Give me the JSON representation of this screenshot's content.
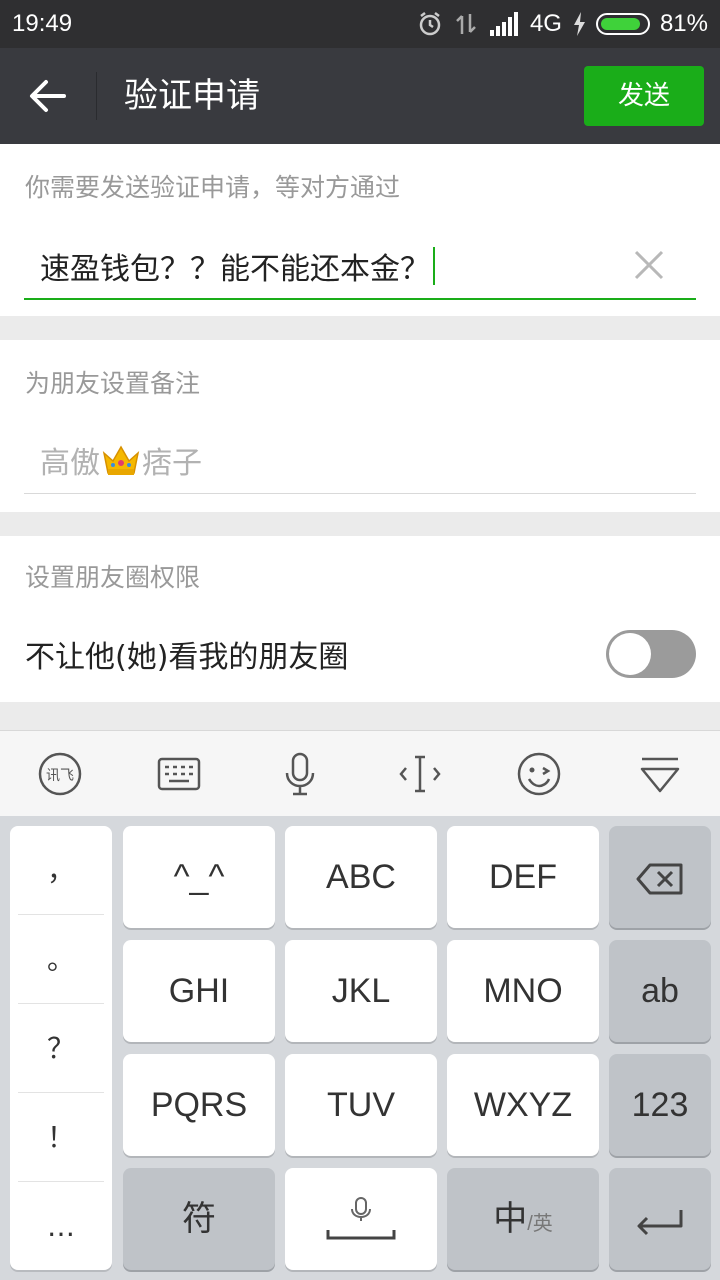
{
  "status_bar": {
    "time": "19:49",
    "network": "4G",
    "battery": "81%"
  },
  "header": {
    "title": "验证申请",
    "send_label": "发送"
  },
  "verify": {
    "label": "你需要发送验证申请，等对方通过",
    "value": "速盈钱包？？能不能还本金？"
  },
  "remark": {
    "label": "为朋友设置备注",
    "placeholder_a": "高傲",
    "placeholder_b": "痞子"
  },
  "moments": {
    "label": "设置朋友圈权限",
    "toggle_label": "不让他(她)看我的朋友圈",
    "toggle_on": false
  },
  "keyboard": {
    "punct": [
      "，",
      "。",
      "？",
      "！",
      "…"
    ],
    "rows": [
      [
        "^_^",
        "ABC",
        "DEF"
      ],
      [
        "GHI",
        "JKL",
        "MNO",
        "ab"
      ],
      [
        "PQRS",
        "TUV",
        "WXYZ",
        "123"
      ],
      [
        "符",
        "",
        "中",
        ""
      ]
    ],
    "lang_sub": "/英"
  },
  "colors": {
    "accent": "#1aad19",
    "header": "#393a3f",
    "statusbar": "#2f2f31"
  }
}
